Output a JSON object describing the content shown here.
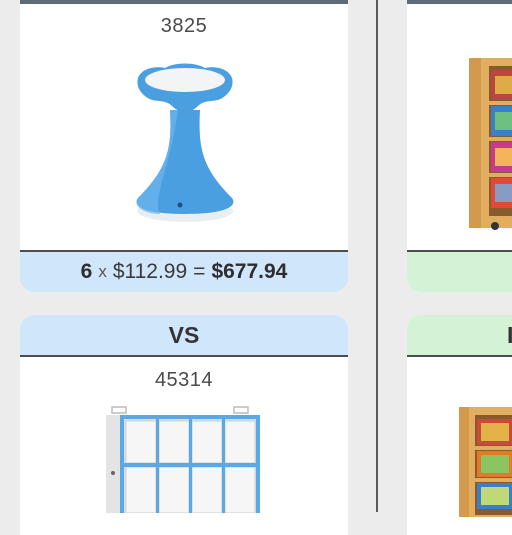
{
  "products": [
    {
      "sku": "3825",
      "calc": {
        "qty": "6",
        "times": "x",
        "unit_price": "$112.99",
        "equals": "=",
        "total": "$677.94"
      }
    },
    {
      "header": "VS",
      "sku": "45314"
    }
  ],
  "right_column": {
    "header_partial": "I"
  },
  "colors": {
    "blue_bar": "#cfe6fb",
    "green_bar": "#d3f2d6",
    "stool_blue": "#4a9fe0"
  }
}
